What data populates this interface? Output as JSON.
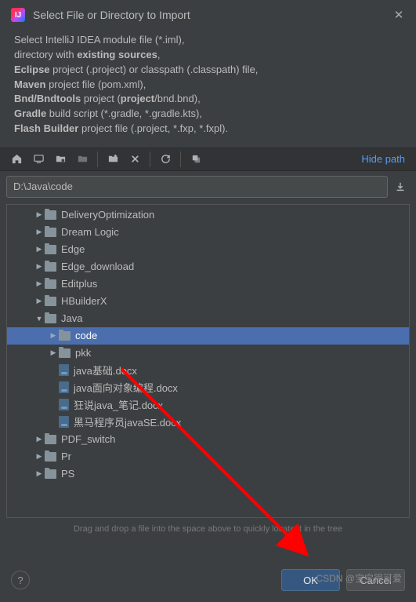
{
  "title": "Select File or Directory to Import",
  "description": {
    "line1_pre": "Select IntelliJ IDEA module file (*.iml),",
    "line2_pre": "directory with ",
    "line2_bold": "existing sources",
    "line2_post": ",",
    "line3_bold": "Eclipse",
    "line3_post": " project (.project) or classpath (.classpath) file,",
    "line4_bold": "Maven",
    "line4_post": " project file (pom.xml),",
    "line5_bold": "Bnd/Bndtools",
    "line5_mid": " project (",
    "line5_bold2": "project",
    "line5_post": "/bnd.bnd),",
    "line6_bold": "Gradle",
    "line6_post": " build script (*.gradle, *.gradle.kts),",
    "line7_bold": "Flash Builder",
    "line7_post": " project file (.project, *.fxp, *.fxpl)."
  },
  "hide_path_label": "Hide path",
  "path_value": "D:\\Java\\code",
  "tree": [
    {
      "name": "DeliveryOptimization",
      "type": "folder",
      "level": 1,
      "expanded": false
    },
    {
      "name": "Dream Logic",
      "type": "folder",
      "level": 1,
      "expanded": false
    },
    {
      "name": "Edge",
      "type": "folder",
      "level": 1,
      "expanded": false
    },
    {
      "name": "Edge_download",
      "type": "folder",
      "level": 1,
      "expanded": false
    },
    {
      "name": "Editplus",
      "type": "folder",
      "level": 1,
      "expanded": false
    },
    {
      "name": "HBuilderX",
      "type": "folder",
      "level": 1,
      "expanded": false
    },
    {
      "name": "Java",
      "type": "folder",
      "level": 1,
      "expanded": true
    },
    {
      "name": "code",
      "type": "folder",
      "level": 2,
      "expanded": false,
      "selected": true
    },
    {
      "name": "pkk",
      "type": "folder",
      "level": 2,
      "expanded": false
    },
    {
      "name": "java基础.docx",
      "type": "doc",
      "level": 2
    },
    {
      "name": "java面向对象编程.docx",
      "type": "doc",
      "level": 2
    },
    {
      "name": "狂说java_笔记.docx",
      "type": "doc",
      "level": 2
    },
    {
      "name": "黑马程序员javaSE.docx",
      "type": "doc",
      "level": 2
    },
    {
      "name": "PDF_switch",
      "type": "folder",
      "level": 1,
      "expanded": false
    },
    {
      "name": "Pr",
      "type": "folder",
      "level": 1,
      "expanded": false
    },
    {
      "name": "PS",
      "type": "folder",
      "level": 1,
      "expanded": false
    }
  ],
  "hint": "Drag and drop a file into the space above to quickly locate it in the tree",
  "buttons": {
    "ok": "OK",
    "cancel": "Cancel",
    "help": "?"
  },
  "watermark": "CSDN @宝宝很可爱"
}
